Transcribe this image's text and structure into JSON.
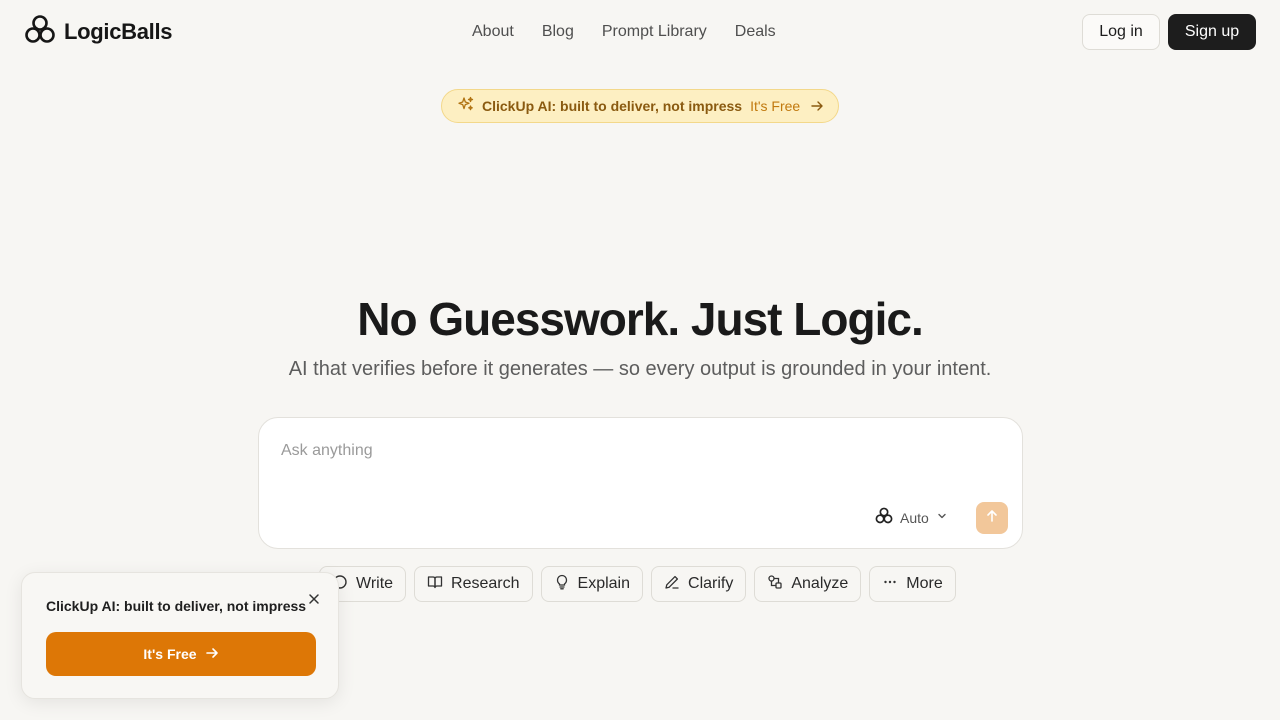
{
  "header": {
    "logo_text": "LogicBalls",
    "nav": [
      "About",
      "Blog",
      "Prompt Library",
      "Deals"
    ],
    "login_label": "Log in",
    "signup_label": "Sign up"
  },
  "promo": {
    "text": "ClickUp AI: built to deliver, not impress",
    "cta": "It's Free"
  },
  "hero": {
    "title": "No Guesswork. Just Logic.",
    "subtitle": "AI that verifies before it generates — so every output is grounded in your intent."
  },
  "ask": {
    "placeholder": "Ask anything",
    "value": "",
    "model": "Auto"
  },
  "chips": [
    {
      "label": "Write",
      "icon": "write-icon"
    },
    {
      "label": "Research",
      "icon": "book-icon"
    },
    {
      "label": "Explain",
      "icon": "lightbulb-icon"
    },
    {
      "label": "Clarify",
      "icon": "pen-icon"
    },
    {
      "label": "Analyze",
      "icon": "analyze-icon"
    },
    {
      "label": "More",
      "icon": "ellipsis-icon"
    }
  ],
  "toast": {
    "text": "ClickUp AI: built to deliver, not impress",
    "button_label": "It's Free"
  },
  "colors": {
    "background": "#f7f6f3",
    "accent": "#dd7706",
    "promo_bg": "#fdefc2",
    "send_btn": "#f2c79a"
  }
}
